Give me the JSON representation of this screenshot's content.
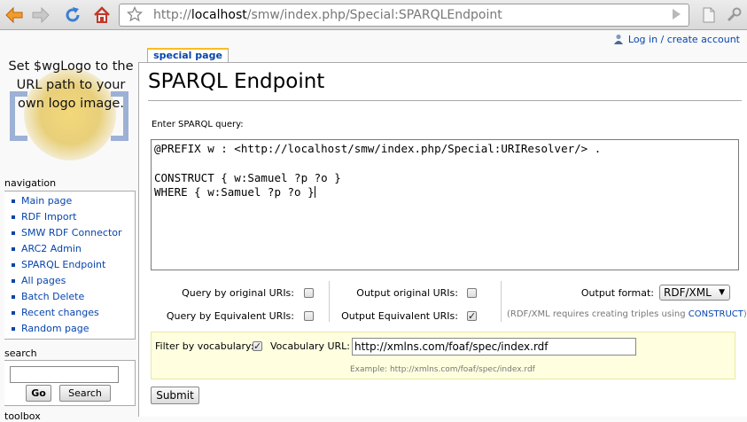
{
  "browser": {
    "url_prefix": "http://",
    "url_host": "localhost",
    "url_path": "/smw/index.php/Special:SPARQLEndpoint",
    "icons": [
      "back-arrow-icon",
      "forward-arrow-icon",
      "reload-icon",
      "home-icon",
      "bookmark-star-icon",
      "go-arrow-icon",
      "page-icon",
      "wrench-icon"
    ]
  },
  "logo": {
    "text": "Set $wgLogo to the URL path to your own logo image."
  },
  "personal": {
    "login_label": "Log in / create account"
  },
  "tab": {
    "label": "special page"
  },
  "sidebar": {
    "navigation_heading": "navigation",
    "items": [
      {
        "label": "Main page"
      },
      {
        "label": "RDF Import"
      },
      {
        "label": "SMW RDF Connector"
      },
      {
        "label": "ARC2 Admin"
      },
      {
        "label": "SPARQL Endpoint"
      },
      {
        "label": "All pages"
      },
      {
        "label": "Batch Delete"
      },
      {
        "label": "Recent changes"
      },
      {
        "label": "Random page"
      }
    ],
    "search_heading": "search",
    "search_value": "",
    "go_label": "Go",
    "search_label": "Search",
    "toolbox_heading": "toolbox"
  },
  "main": {
    "title": "SPARQL Endpoint",
    "query_label": "Enter SPARQL query:",
    "query_lines": [
      "@PREFIX w : <http://localhost/smw/index.php/Special:URIResolver/> .",
      "",
      "CONSTRUCT { w:Samuel ?p ?o }",
      "WHERE { w:Samuel ?p ?o }"
    ],
    "options": {
      "query_original": {
        "label": "Query by original URIs:",
        "checked": false
      },
      "query_equivalent": {
        "label": "Query by Equivalent URIs:",
        "checked": false
      },
      "output_original": {
        "label": "Output original URIs:",
        "checked": false
      },
      "output_equivalent": {
        "label": "Output Equivalent URIs:",
        "checked": true
      }
    },
    "output_format_label": "Output format:",
    "output_format_value": "RDF/XML",
    "format_note_prefix": "(RDF/XML requires creating triples using ",
    "format_note_link": "CONSTRUCT",
    "format_note_suffix": ")",
    "vocab": {
      "filter_label": "Filter by vocabulary:",
      "filter_checked": true,
      "url_label": "Vocabulary URL:",
      "url_value": "http://xmlns.com/foaf/spec/index.rdf",
      "example": "Example: http://xmlns.com/foaf/spec/index.rdf"
    },
    "submit_label": "Submit"
  }
}
